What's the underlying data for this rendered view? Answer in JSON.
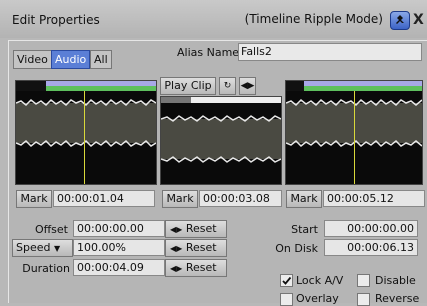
{
  "window": {
    "title": "Edit Properties",
    "mode": "(Timeline Ripple Mode)",
    "close_glyph": "X"
  },
  "tabs": [
    {
      "label": "Video",
      "active": false
    },
    {
      "label": "Audio",
      "active": true
    },
    {
      "label": "All",
      "active": false
    }
  ],
  "alias": {
    "label": "Alias Name",
    "value": "Falls2"
  },
  "player": {
    "play_clip_label": "Play Clip",
    "loop_icon": "loop-icon",
    "jog_icon": "jog-arrows-icon"
  },
  "marks": [
    {
      "label": "Mark",
      "timecode": "00:00:01.04"
    },
    {
      "label": "Mark",
      "timecode": "00:00:03.08"
    },
    {
      "label": "Mark",
      "timecode": "00:00:05.12"
    }
  ],
  "offset": {
    "label": "Offset",
    "value": "00:00:00.00",
    "reset_label": "Reset"
  },
  "speed": {
    "label": "Speed",
    "value": "100.00%",
    "reset_label": "Reset"
  },
  "duration": {
    "label": "Duration",
    "value": "00:00:04.09",
    "reset_label": "Reset"
  },
  "start": {
    "label": "Start",
    "value": "00:00:00.00"
  },
  "on_disk": {
    "label": "On Disk",
    "value": "00:00:06.13"
  },
  "options": [
    {
      "label": "Lock A/V",
      "checked": true
    },
    {
      "label": "Disable",
      "checked": false
    },
    {
      "label": "Overlay",
      "checked": false
    },
    {
      "label": "Reverse",
      "checked": false
    }
  ],
  "colors": {
    "accent": "#5b7fd6",
    "bar_blue": "#a8a8e8",
    "bar_green": "#5ec05e",
    "playhead": "#d9d83a"
  }
}
